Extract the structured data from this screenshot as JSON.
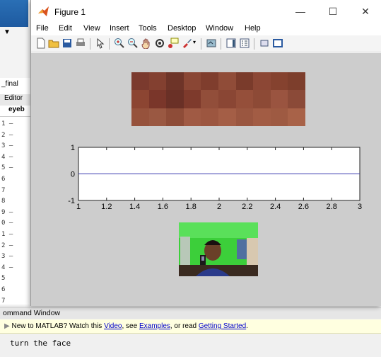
{
  "background": {
    "file_label": "_final",
    "editor_tab": "Editor",
    "editor_file": "eyeb",
    "line_numbers": [
      "1 –",
      "2 –",
      "3 –",
      "4 –",
      "5 –",
      "6",
      "7",
      "8",
      "9 –",
      "0 –",
      "1 –",
      "2 –",
      "3 –",
      "4 –",
      "5",
      "6",
      "7"
    ]
  },
  "figure": {
    "title": "Figure 1",
    "minimize": "—",
    "maximize": "☐",
    "close": "✕",
    "menu": [
      "File",
      "Edit",
      "View",
      "Insert",
      "Tools",
      "Desktop",
      "Window",
      "Help"
    ],
    "toolbar_icons": [
      "new-file-icon",
      "open-folder-icon",
      "save-icon",
      "print-icon",
      "pointer-icon",
      "zoom-in-icon",
      "zoom-out-icon",
      "pan-icon",
      "rotate-icon",
      "data-cursor-icon",
      "brush-icon",
      "link-icon",
      "colorbar-icon",
      "legend-icon",
      "hide-tools-icon",
      "show-tools-icon"
    ]
  },
  "chart_data": {
    "type": "line",
    "series": [
      {
        "x": [
          1,
          1.5,
          2,
          2.5,
          3
        ],
        "values": [
          0,
          0,
          0,
          0,
          0
        ],
        "color": "#3a3ab0"
      }
    ],
    "xlim": [
      1,
      3
    ],
    "ylim": [
      -1,
      1
    ],
    "xticks": [
      "1",
      "1.2",
      "1.4",
      "1.6",
      "1.8",
      "2",
      "2.2",
      "2.4",
      "2.6",
      "2.8",
      "3"
    ],
    "yticks": [
      "-1",
      "0",
      "1"
    ],
    "title": "",
    "xlabel": "",
    "ylabel": ""
  },
  "command_window": {
    "title": "ommand Window",
    "notice_prefix": "New to MATLAB? Watch this ",
    "link_video": "Video",
    "sep1": ", see ",
    "link_examples": "Examples",
    "sep2": ", or read ",
    "link_getting_started": "Getting Started",
    "notice_suffix": ".",
    "output": "turn the face"
  },
  "colors": {
    "canvas": "#cdcdcd",
    "plot_line": "#3a3ab0",
    "crop_base": "#7a3a2a"
  }
}
